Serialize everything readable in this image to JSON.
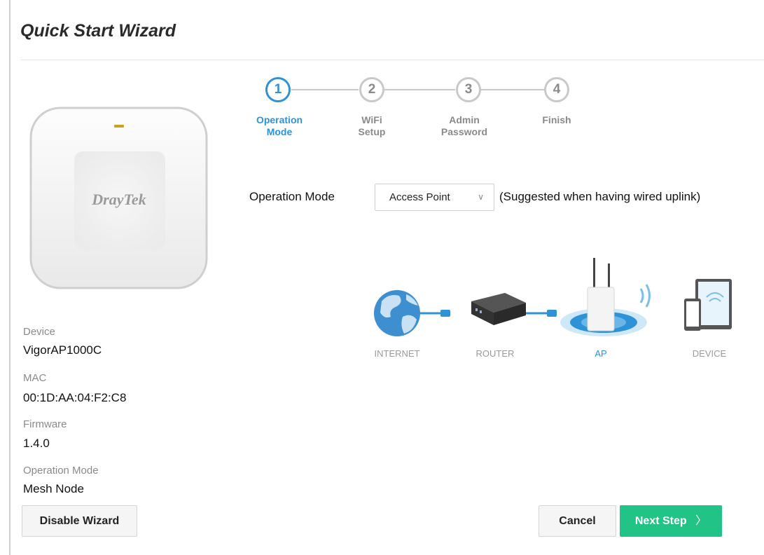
{
  "title": "Quick Start Wizard",
  "device_image": {
    "brand": "DrayTek",
    "led_color": "#c8a41e"
  },
  "info": {
    "device_label": "Device",
    "device_value": "VigorAP1000C",
    "mac_label": "MAC",
    "mac_value": "00:1D:AA:04:F2:C8",
    "firmware_label": "Firmware",
    "firmware_value": "1.4.0",
    "opmode_label": "Operation Mode",
    "opmode_value": "Mesh Node"
  },
  "steps": [
    {
      "number": "1",
      "line1": "Operation",
      "line2": "Mode",
      "active": true
    },
    {
      "number": "2",
      "line1": "WiFi",
      "line2": "Setup",
      "active": false
    },
    {
      "number": "3",
      "line1": "Admin",
      "line2": "Password",
      "active": false
    },
    {
      "number": "4",
      "line1": "Finish",
      "line2": "",
      "active": false
    }
  ],
  "operation_mode": {
    "label": "Operation Mode",
    "selected": "Access Point",
    "hint": "(Suggested when having wired uplink)"
  },
  "diagram": {
    "labels": [
      "INTERNET",
      "ROUTER",
      "AP",
      "DEVICE"
    ],
    "icons": [
      "globe-icon",
      "router-icon",
      "access-point-icon",
      "devices-icon"
    ]
  },
  "buttons": {
    "disable": "Disable Wizard",
    "cancel": "Cancel",
    "next": "Next Step"
  },
  "colors": {
    "accent": "#2d93d6",
    "primary_button": "#22c387",
    "inactive": "#8a8a8a"
  }
}
